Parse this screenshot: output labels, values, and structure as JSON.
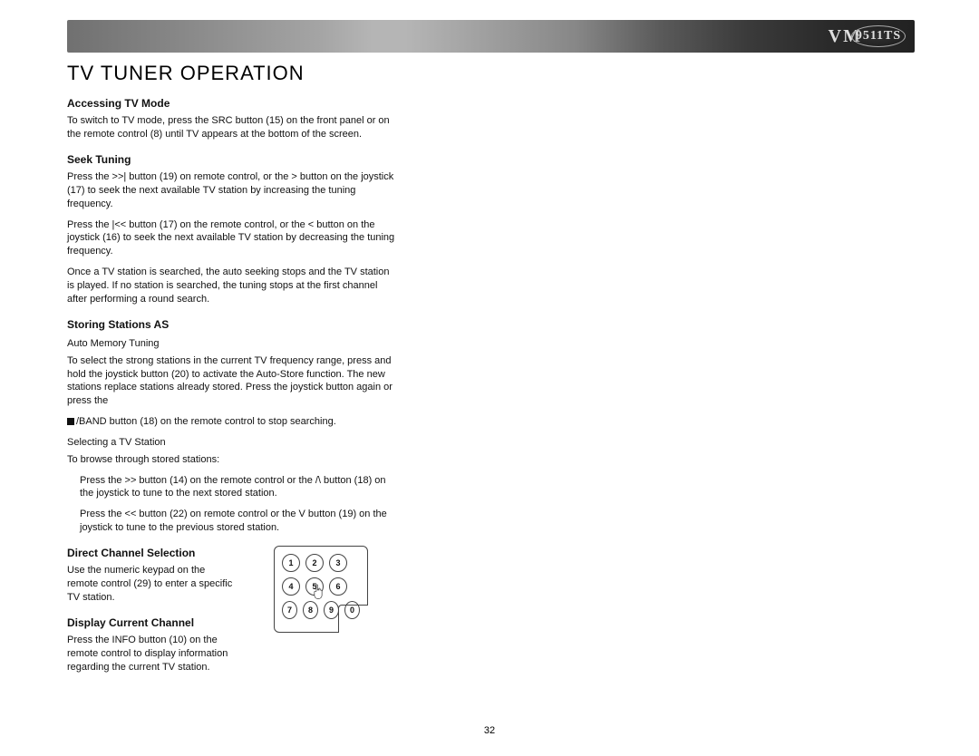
{
  "header": {
    "model_prefix": "VM",
    "model_rest": "9511TS"
  },
  "page_title": "TV TUNER OPERATION",
  "page_number": "32",
  "sections": {
    "accessing": {
      "heading": "Accessing TV Mode",
      "p1": "To switch to TV mode, press the SRC button (15) on the front panel or on the remote control (8) until  TV  appears at the bottom of the screen."
    },
    "seek": {
      "heading": "Seek Tuning",
      "p1": "Press the >>| button (19) on remote control, or the > button on the joystick (17) to seek the next available TV station by increasing the tuning frequency.",
      "p2": "Press the |<< button (17) on the remote control, or the < button on the joystick (16) to seek the next available TV station by decreasing the tuning frequency.",
      "p3": "Once a TV station is searched, the auto seeking stops and the TV station is played. If no station is searched, the tuning stops at the first channel after performing a round search."
    },
    "storing": {
      "heading": "Storing Stations AS",
      "sub1": "Auto Memory Tuning",
      "p1": "To select the strong stations in the current TV frequency range, press and hold the joystick button (20) to activate the Auto-Store function. The new stations replace stations already stored. Press the joystick button again or press the",
      "band_line": "/BAND button (18) on the remote control to stop searching.",
      "sub2": "Selecting a TV Station",
      "p2": "To browse through stored stations:",
      "li1": "Press the >> button (14) on the remote control or the /\\ button (18) on the joystick to tune to the next stored station.",
      "li2": "Press the << button (22) on remote control or the V button (19) on the joystick to tune to the previous stored station."
    },
    "direct": {
      "heading": "Direct Channel Selection",
      "p1": "Use the numeric keypad on the remote control (29) to enter a specific TV station."
    },
    "display": {
      "heading": "Display Current Channel",
      "p1": "Press the INFO button (10) on the remote control to display information regarding the current TV station."
    }
  },
  "keypad": {
    "keys_row1": [
      "1",
      "2",
      "3"
    ],
    "keys_row2": [
      "4",
      "5",
      "6"
    ],
    "keys_row3": [
      "7",
      "8",
      "9",
      "0"
    ]
  }
}
